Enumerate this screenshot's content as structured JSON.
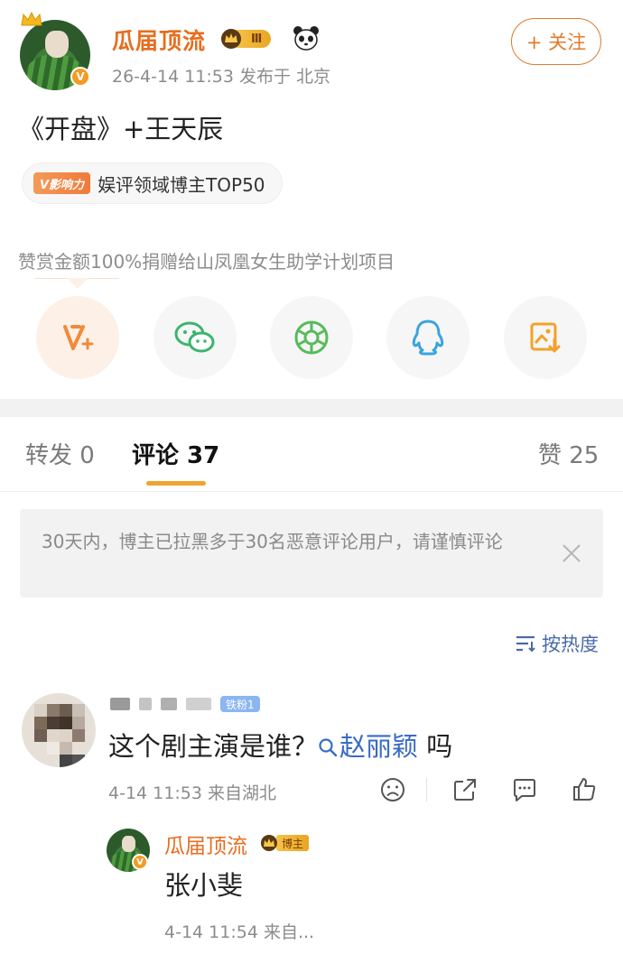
{
  "post": {
    "username": "瓜届顶流",
    "level_badge": "Ⅲ",
    "date_location": "26-4-14 11:53  发布于 北京",
    "follow_label": "+ 关注",
    "text": "《开盘》+王天辰",
    "influence_tag": "V影响力",
    "influence_text": "娱评领域博主TOP50",
    "donate_note": "赞赏金额100%捐赠给山凤凰女生助学计划项目"
  },
  "share_buttons": [
    {
      "icon": "vplus-icon"
    },
    {
      "icon": "wechat-icon"
    },
    {
      "icon": "moments-icon"
    },
    {
      "icon": "qq-icon"
    },
    {
      "icon": "save-image-icon"
    }
  ],
  "tabs": {
    "repost": "转发 0",
    "comments": "评论 37",
    "likes": "赞 25"
  },
  "notice": "30天内，博主已拉黑多于30名恶意评论用户，请谨慎评论",
  "sort_label": "按热度",
  "comment": {
    "fan_badge": "铁粉1",
    "text_before": "这个剧主演是谁？",
    "topic": "赵丽颖",
    "text_after": " 吗",
    "meta": "4-14 11:53  来自湖北"
  },
  "reply": {
    "username": "瓜届顶流",
    "badge": "博主",
    "text": "张小斐",
    "meta": "4-14 11:54  来自..."
  },
  "colors": {
    "accent_orange": "#e76d1f",
    "link_blue": "#3a6bc4",
    "tab_underline": "#f0a332"
  }
}
